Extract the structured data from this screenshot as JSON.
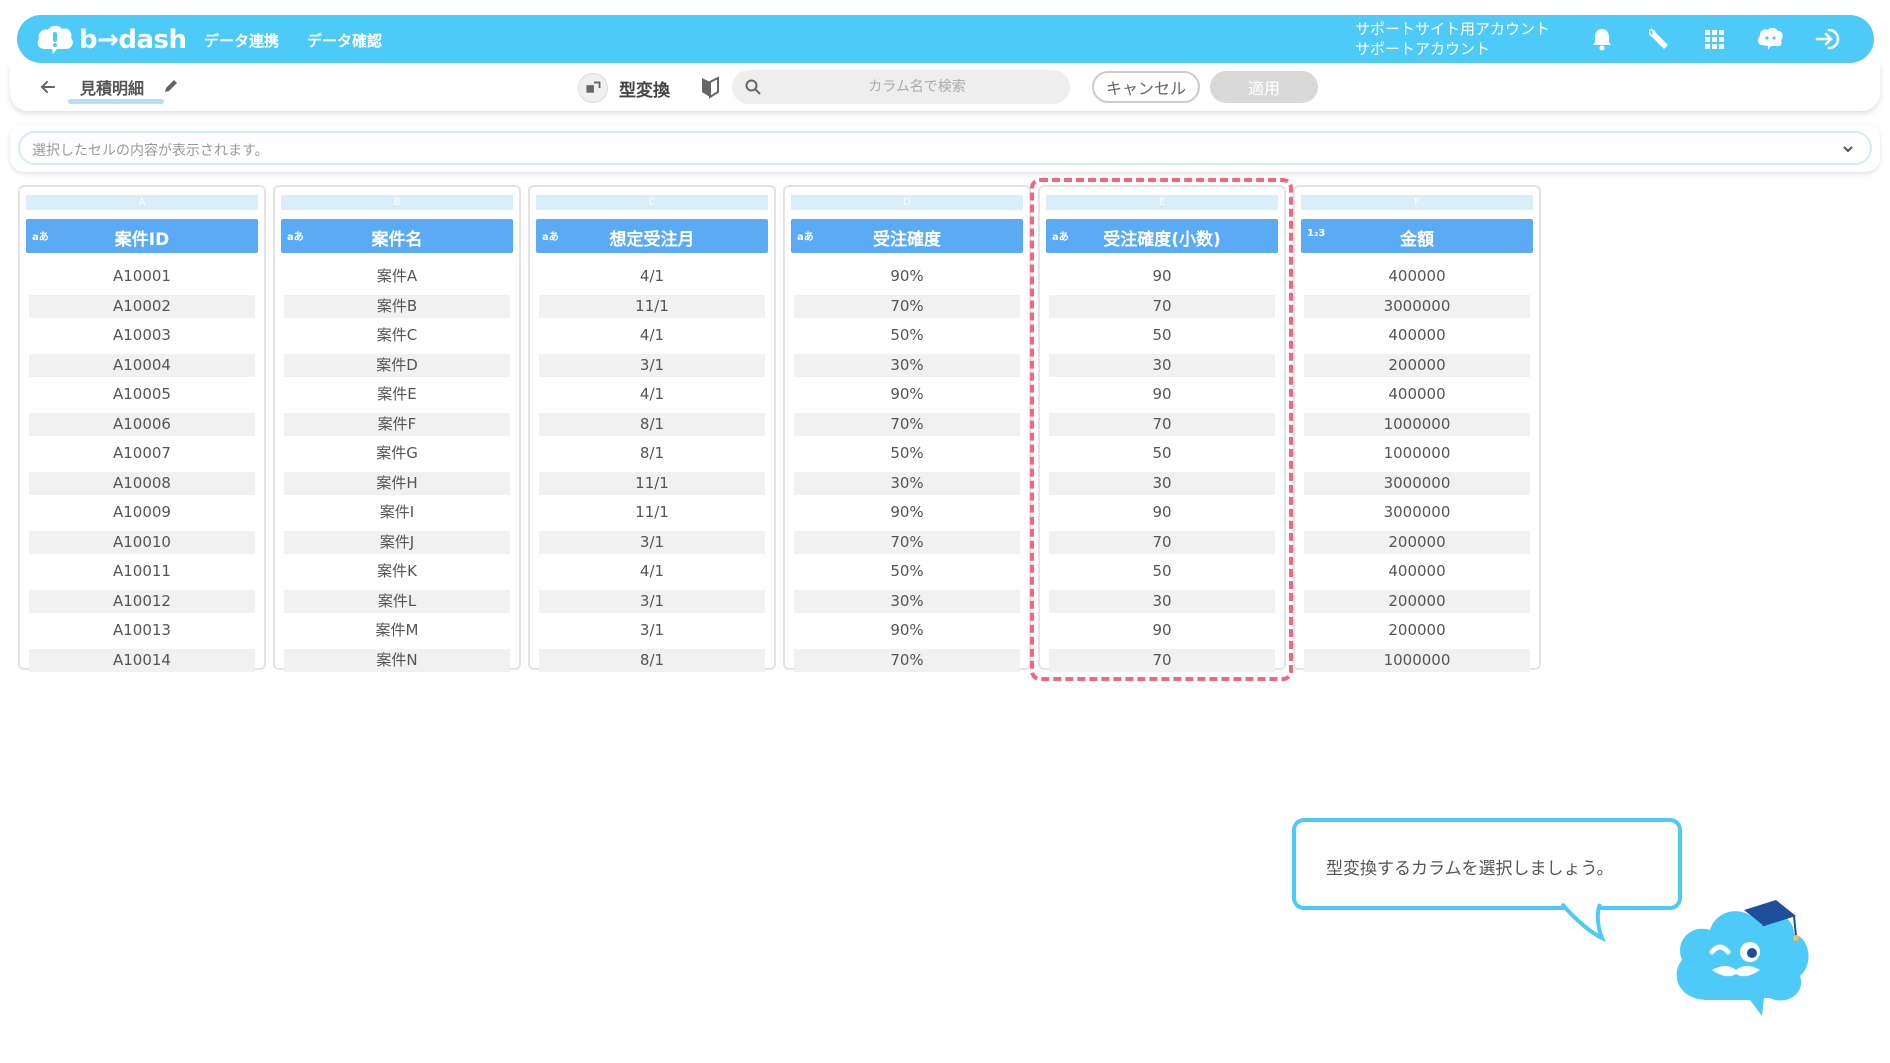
{
  "header": {
    "logo_text": "b→dash",
    "nav": [
      "データ連携",
      "データ確認"
    ],
    "account_line1": "サポートサイト用アカウント",
    "account_line2": "サポートアカウント",
    "icons": [
      "bell-icon",
      "wrench-icon",
      "grid-menu-icon",
      "chat-bot-icon",
      "logout-icon"
    ],
    "brand_color": "#4dcaf7"
  },
  "toolbar": {
    "sheet_name": "見積明細",
    "mode_label": "型変換",
    "search_placeholder": "カラム名で検索",
    "cancel_label": "キャンセル",
    "apply_label": "適用"
  },
  "cellbar": {
    "placeholder": "選択したセルの内容が表示されます。"
  },
  "columns": [
    {
      "letter": "A",
      "type_tag": "aあ",
      "name": "案件ID",
      "values": [
        "A10001",
        "A10002",
        "A10003",
        "A10004",
        "A10005",
        "A10006",
        "A10007",
        "A10008",
        "A10009",
        "A10010",
        "A10011",
        "A10012",
        "A10013",
        "A10014"
      ]
    },
    {
      "letter": "B",
      "type_tag": "aあ",
      "name": "案件名",
      "values": [
        "案件A",
        "案件B",
        "案件C",
        "案件D",
        "案件E",
        "案件F",
        "案件G",
        "案件H",
        "案件I",
        "案件J",
        "案件K",
        "案件L",
        "案件M",
        "案件N"
      ]
    },
    {
      "letter": "C",
      "type_tag": "aあ",
      "name": "想定受注月",
      "values": [
        "4/1",
        "11/1",
        "4/1",
        "3/1",
        "4/1",
        "8/1",
        "8/1",
        "11/1",
        "11/1",
        "3/1",
        "4/1",
        "3/1",
        "3/1",
        "8/1"
      ]
    },
    {
      "letter": "D",
      "type_tag": "aあ",
      "name": "受注確度",
      "values": [
        "90%",
        "70%",
        "50%",
        "30%",
        "90%",
        "70%",
        "50%",
        "30%",
        "90%",
        "70%",
        "50%",
        "30%",
        "90%",
        "70%"
      ]
    },
    {
      "letter": "E",
      "type_tag": "aあ",
      "name": "受注確度(小数)",
      "values": [
        "90",
        "70",
        "50",
        "30",
        "90",
        "70",
        "50",
        "30",
        "90",
        "70",
        "50",
        "30",
        "90",
        "70"
      ]
    },
    {
      "letter": "F",
      "type_tag": "1₂3",
      "name": "金額",
      "values": [
        "400000",
        "3000000",
        "400000",
        "200000",
        "400000",
        "1000000",
        "1000000",
        "3000000",
        "3000000",
        "200000",
        "400000",
        "200000",
        "200000",
        "1000000"
      ]
    }
  ],
  "highlight_color": "#f0687a",
  "tooltip": {
    "message": "型変換するカラムを選択しましょう。"
  }
}
